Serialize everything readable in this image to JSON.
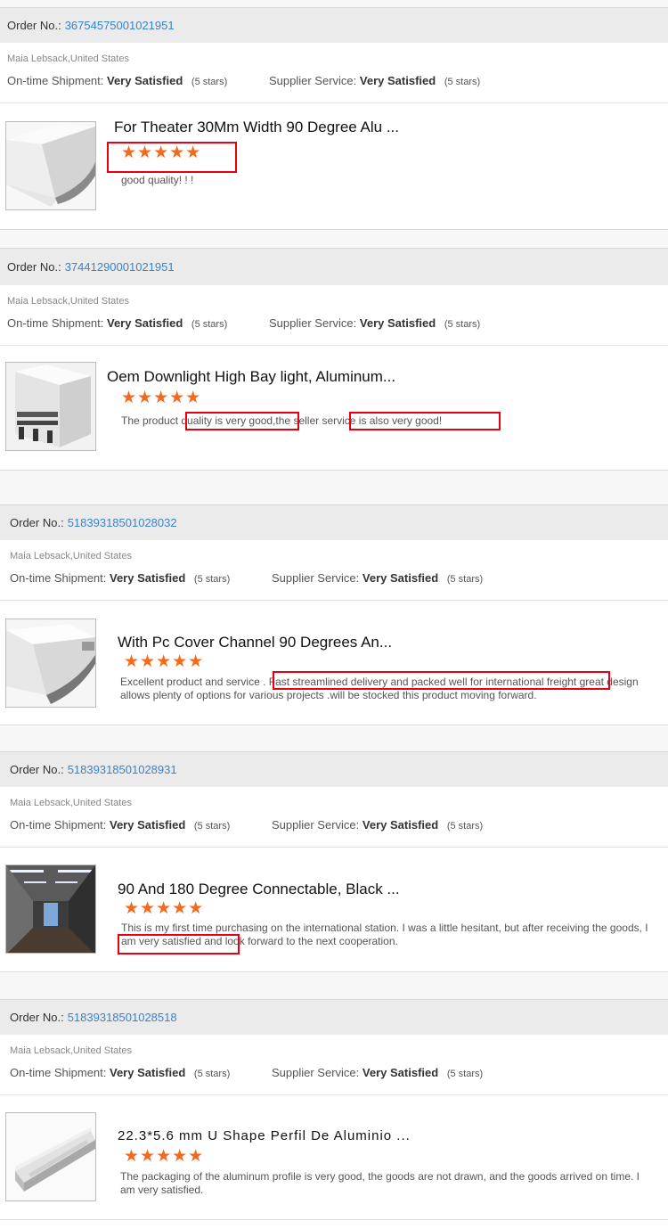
{
  "reviews": [
    {
      "order_label": "Order No.:",
      "order_number": "36754575001021951",
      "buyer": "Maia Lebsack,United States",
      "shipment_label": "On-time Shipment:",
      "shipment_value": "Very Satisfied",
      "shipment_stars": "(5 stars)",
      "service_label": "Supplier Service:",
      "service_value": "Very Satisfied",
      "service_stars": "(5 stars)",
      "product_title": "For Theater 30Mm Width 90 Degree Alu ...",
      "rating": 5,
      "stars": "★★★★★",
      "review": "good quality! ! !"
    },
    {
      "order_label": "Order No.:",
      "order_number": "37441290001021951",
      "buyer": "Maia Lebsack,United States",
      "shipment_label": "On-time Shipment:",
      "shipment_value": "Very Satisfied",
      "shipment_stars": "(5 stars)",
      "service_label": "Supplier Service:",
      "service_value": "Very Satisfied",
      "service_stars": "(5 stars)",
      "product_title": "Oem Downlight High Bay light, Aluminum...",
      "rating": 5,
      "stars": "★★★★★",
      "review": "The product quality is very good,the seller service is also very good!"
    },
    {
      "order_label": "Order No.:",
      "order_number": "51839318501028032",
      "buyer": "Maia Lebsack,United States",
      "shipment_label": "On-time Shipment:",
      "shipment_value": "Very Satisfied",
      "shipment_stars": "(5 stars)",
      "service_label": "Supplier Service:",
      "service_value": "Very Satisfied",
      "service_stars": "(5 stars)",
      "product_title": "With Pc Cover Channel 90 Degrees An...",
      "rating": 5,
      "stars": "★★★★★",
      "review": "Excellent product and service . Fast streamlined delivery and packed well for international freight great design allows plenty of options for various projects .will be stocked this product moving forward."
    },
    {
      "order_label": "Order No.:",
      "order_number": "51839318501028931",
      "buyer": "Maia Lebsack,United States",
      "shipment_label": "On-time Shipment:",
      "shipment_value": "Very Satisfied",
      "shipment_stars": "(5 stars)",
      "service_label": "Supplier Service:",
      "service_value": "Very Satisfied",
      "service_stars": "(5 stars)",
      "product_title": "90 And 180 Degree Connectable, Black ...",
      "rating": 5,
      "stars": "★★★★★",
      "review": "This is my first time purchasing on the international station. I was a little hesitant, but after receiving the goods, I am very satisfied and look forward to the next cooperation."
    },
    {
      "order_label": "Order No.:",
      "order_number": "51839318501028518",
      "buyer": "Maia Lebsack,United States",
      "shipment_label": "On-time Shipment:",
      "shipment_value": "Very Satisfied",
      "shipment_stars": "(5 stars)",
      "service_label": "Supplier Service:",
      "service_value": "Very Satisfied",
      "service_stars": "(5 stars)",
      "product_title": "22.3*5.6 mm U Shape Perfil De Aluminio ...",
      "rating": 5,
      "stars": "★★★★★",
      "review": "The packaging of the aluminum profile is very good, the goods are not drawn, and the goods arrived on time. I am very satisfied."
    }
  ],
  "colors": {
    "link": "#3b83c8",
    "star": "#f36a1f",
    "highlight": "#e60012"
  }
}
